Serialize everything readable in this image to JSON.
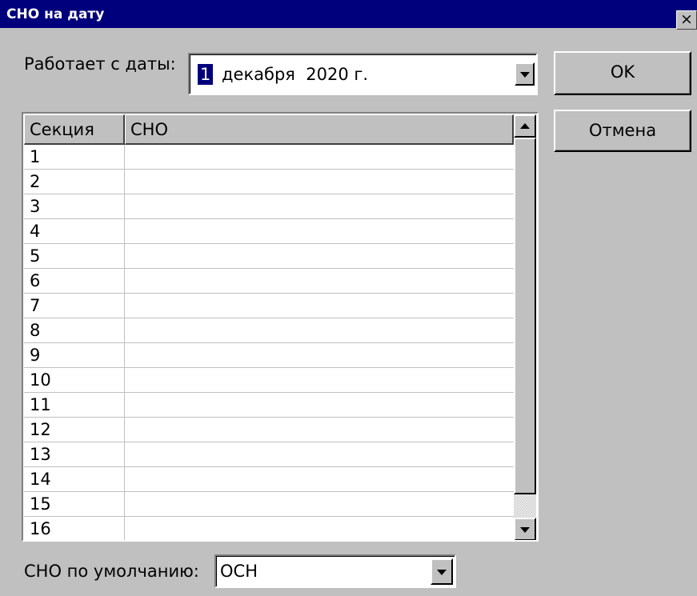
{
  "window": {
    "title": "СНО на дату",
    "close_glyph": "×"
  },
  "date": {
    "label": "Работает с даты:",
    "day": "1",
    "rest": "декабря  2020 г."
  },
  "buttons": {
    "ok": "OK",
    "cancel": "Отмена"
  },
  "table": {
    "columns": [
      "Секция",
      "СНО"
    ],
    "rows": [
      {
        "section": "1",
        "sno": ""
      },
      {
        "section": "2",
        "sno": ""
      },
      {
        "section": "3",
        "sno": ""
      },
      {
        "section": "4",
        "sno": ""
      },
      {
        "section": "5",
        "sno": ""
      },
      {
        "section": "6",
        "sno": ""
      },
      {
        "section": "7",
        "sno": ""
      },
      {
        "section": "8",
        "sno": ""
      },
      {
        "section": "9",
        "sno": ""
      },
      {
        "section": "10",
        "sno": ""
      },
      {
        "section": "11",
        "sno": ""
      },
      {
        "section": "12",
        "sno": ""
      },
      {
        "section": "13",
        "sno": ""
      },
      {
        "section": "14",
        "sno": ""
      },
      {
        "section": "15",
        "sno": ""
      },
      {
        "section": "16",
        "sno": ""
      }
    ]
  },
  "default_sno": {
    "label": "СНО по умолчанию:",
    "value": "ОСН"
  },
  "colors": {
    "titlebar": "#00007c",
    "face": "#c0c0c0",
    "highlight": "#00007c"
  }
}
